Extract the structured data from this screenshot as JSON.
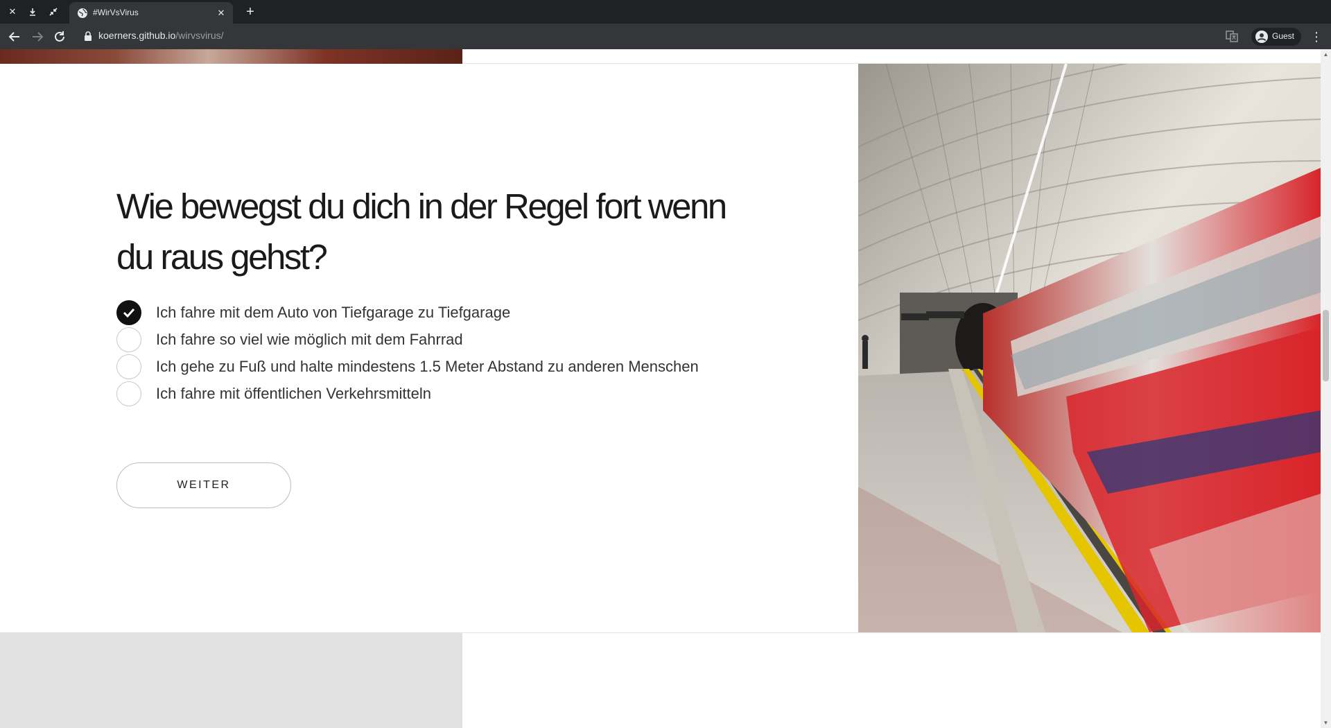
{
  "browser": {
    "tab_title": "#WirVsVirus",
    "url_host": "koerners.github.io",
    "url_path": "/wirvsvirus/",
    "profile_label": "Guest"
  },
  "quiz": {
    "question": "Wie bewegst du dich in der Regel fort wenn du raus gehst?",
    "options": [
      {
        "label": "Ich fahre mit dem Auto von Tiefgarage zu Tiefgarage",
        "selected": true
      },
      {
        "label": "Ich fahre so viel wie möglich mit dem Fahrrad",
        "selected": false
      },
      {
        "label": "Ich gehe zu Fuß und halte mindestens 1.5 Meter Abstand zu anderen Menschen",
        "selected": false
      },
      {
        "label": "Ich fahre mit öffentlichen Verkehrsmitteln",
        "selected": false
      }
    ],
    "next_label": "WEITER"
  },
  "colors": {
    "chrome_dark": "#202124",
    "chrome_toolbar": "#35363a",
    "selected_radio": "#111111",
    "train_red": "#d8252a"
  }
}
